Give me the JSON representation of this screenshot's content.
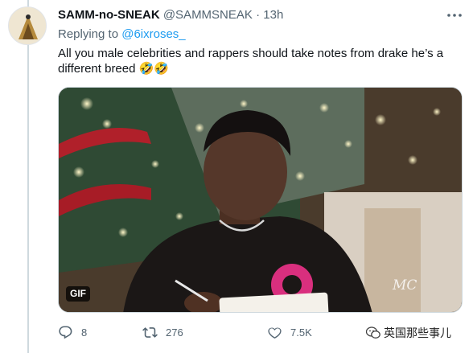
{
  "tweet": {
    "display_name": "SAMM-no-SNEAK",
    "handle": "@SAMMSNEAK",
    "separator": "·",
    "time": "13h",
    "replying_prefix": "Replying to ",
    "replying_to": "@6ixroses_",
    "text": "All you male celebrities and rappers should take notes from drake he’s a different breed 🤣🤣"
  },
  "media": {
    "badge": "GIF",
    "watermark": "MC"
  },
  "actions": {
    "reply_count": "8",
    "retweet_count": "276",
    "like_count": "7.5K"
  },
  "overlay": {
    "account_tag": "英国那些事儿"
  },
  "icons": {
    "more": "more-icon",
    "reply": "reply-icon",
    "retweet": "retweet-icon",
    "like": "heart-icon",
    "account": "wechat-icon"
  },
  "colors": {
    "text": "#0f1419",
    "secondary": "#536471",
    "link": "#1d9bf0",
    "border": "#cfd9de"
  }
}
